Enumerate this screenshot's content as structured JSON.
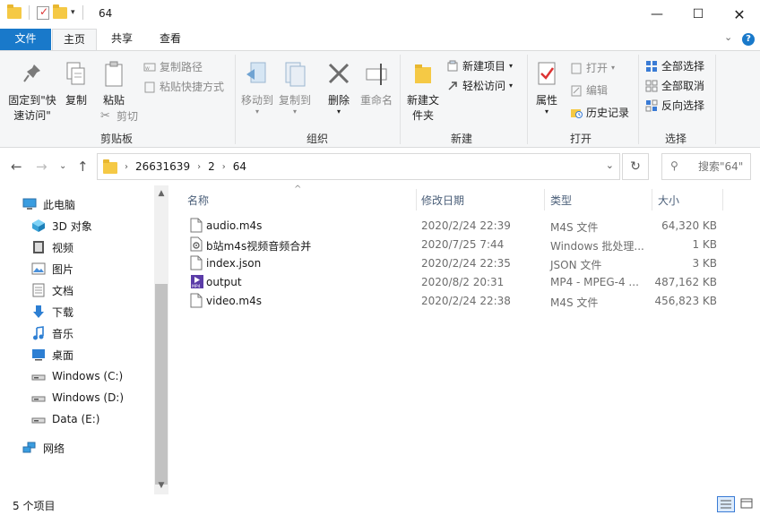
{
  "window": {
    "title": "64"
  },
  "tabs": {
    "file": "文件",
    "home": "主页",
    "share": "共享",
    "view": "查看"
  },
  "ribbon": {
    "clipboard": {
      "pin": "固定到\"快速访问\"",
      "copy": "复制",
      "paste": "粘贴",
      "copy_path": "复制路径",
      "paste_shortcut": "粘贴快捷方式",
      "cut": "剪切",
      "label": "剪贴板"
    },
    "organize": {
      "move_to": "移动到",
      "copy_to": "复制到",
      "delete": "删除",
      "rename": "重命名",
      "label": "组织"
    },
    "new": {
      "new_folder": "新建文件夹",
      "new_item": "新建项目",
      "easy_access": "轻松访问",
      "label": "新建"
    },
    "open": {
      "properties": "属性",
      "open": "打开",
      "edit": "编辑",
      "history": "历史记录",
      "label": "打开"
    },
    "select": {
      "select_all": "全部选择",
      "select_none": "全部取消",
      "invert": "反向选择",
      "label": "选择"
    }
  },
  "address": {
    "crumbs": [
      "26631639",
      "2",
      "64"
    ],
    "search_placeholder": "搜索\"64\""
  },
  "sidebar": {
    "items": [
      {
        "label": "此电脑",
        "icon": "computer-icon"
      },
      {
        "label": "3D 对象",
        "icon": "3d-objects-icon"
      },
      {
        "label": "视频",
        "icon": "video-icon"
      },
      {
        "label": "图片",
        "icon": "picture-icon"
      },
      {
        "label": "文档",
        "icon": "document-icon"
      },
      {
        "label": "下载",
        "icon": "download-icon"
      },
      {
        "label": "音乐",
        "icon": "music-icon"
      },
      {
        "label": "桌面",
        "icon": "desktop-icon"
      },
      {
        "label": "Windows (C:)",
        "icon": "drive-icon"
      },
      {
        "label": "Windows (D:)",
        "icon": "drive-icon"
      },
      {
        "label": "Data (E:)",
        "icon": "drive-icon"
      },
      {
        "label": "网络",
        "icon": "network-icon"
      }
    ]
  },
  "columns": {
    "name": "名称",
    "date": "修改日期",
    "type": "类型",
    "size": "大小"
  },
  "files": [
    {
      "name": "audio.m4s",
      "date": "2020/2/24 22:39",
      "type": "M4S 文件",
      "size": "64,320 KB",
      "icon": "file-icon"
    },
    {
      "name": "b站m4s视频音频合并",
      "date": "2020/7/25 7:44",
      "type": "Windows 批处理...",
      "size": "1 KB",
      "icon": "batch-file-icon"
    },
    {
      "name": "index.json",
      "date": "2020/2/24 22:35",
      "type": "JSON 文件",
      "size": "3 KB",
      "icon": "file-icon"
    },
    {
      "name": "output",
      "date": "2020/8/2 20:31",
      "type": "MP4 - MPEG-4 ...",
      "size": "487,162 KB",
      "icon": "mp4-icon"
    },
    {
      "name": "video.m4s",
      "date": "2020/2/24 22:38",
      "type": "M4S 文件",
      "size": "456,823 KB",
      "icon": "file-icon"
    }
  ],
  "status": {
    "count": "5 个项目"
  },
  "colors": {
    "accent": "#1979ca",
    "folder": "#f5c945"
  }
}
